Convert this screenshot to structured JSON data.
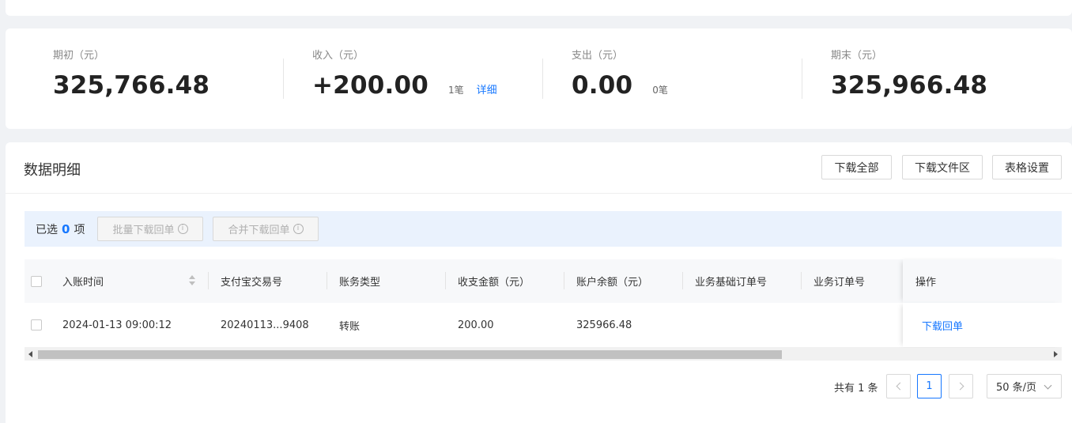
{
  "summary": {
    "opening": {
      "label": "期初（元）",
      "value": "325,766.48"
    },
    "income": {
      "label": "收入（元）",
      "value": "+200.00",
      "count": "1笔",
      "link": "详细"
    },
    "expense": {
      "label": "支出（元）",
      "value": "0.00",
      "count": "0笔"
    },
    "closing": {
      "label": "期末（元）",
      "value": "325,966.48"
    }
  },
  "detail": {
    "title": "数据明细",
    "buttons": {
      "download_all": "下载全部",
      "download_files": "下载文件区",
      "table_settings": "表格设置"
    }
  },
  "selection": {
    "prefix": "已选",
    "count": "0",
    "suffix": "项",
    "batch_download": "批量下载回单",
    "merge_download": "合并下载回单",
    "info_glyph": "i"
  },
  "table": {
    "columns": [
      "入账时间",
      "支付宝交易号",
      "账务类型",
      "收支金额（元）",
      "账户余额（元）",
      "业务基础订单号",
      "业务订单号",
      "操作"
    ],
    "rows": [
      {
        "time": "2024-01-13 09:00:12",
        "trade_no": "20240113...9408",
        "type": "转账",
        "amount": "200.00",
        "balance": "325966.48",
        "base_order": "",
        "order": "",
        "action": "下载回单"
      }
    ]
  },
  "pagination": {
    "total": "共有 1 条",
    "current_page": "1",
    "page_size": "50 条/页"
  },
  "colors": {
    "accent": "#1677ff",
    "selection_bg": "#eaf2fd",
    "page_bg": "#f0f2f5"
  }
}
